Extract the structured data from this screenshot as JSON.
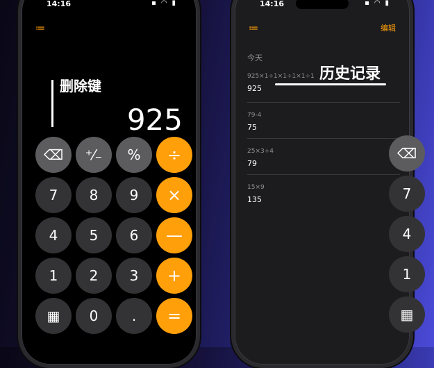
{
  "status": {
    "time": "14:16",
    "icons": "▪ ◠ ▮"
  },
  "left": {
    "menu_icon": "≔",
    "annotation": "删除键",
    "display": "925",
    "keys": [
      [
        "⌫",
        "⁺⁄₋",
        "%",
        "÷"
      ],
      [
        "7",
        "8",
        "9",
        "×"
      ],
      [
        "4",
        "5",
        "6",
        "—"
      ],
      [
        "1",
        "2",
        "3",
        "+"
      ],
      [
        "▦",
        "0",
        ".",
        "="
      ]
    ]
  },
  "right": {
    "menu_icon": "≔",
    "edit": "编辑",
    "section": "今天",
    "annotation": "历史记录",
    "history": [
      {
        "expr": "925×1÷1×1÷1×1÷1",
        "result": "925"
      },
      {
        "expr": "79-4",
        "result": "75"
      },
      {
        "expr": "25×3+4",
        "result": "79"
      },
      {
        "expr": "15×9",
        "result": "135"
      }
    ],
    "ghost_keys": [
      "⌫",
      "7",
      "4",
      "1",
      "▦"
    ]
  },
  "colors": {
    "accent": "#ff9f0a",
    "func": "#5c5c5e",
    "num": "#333335"
  }
}
